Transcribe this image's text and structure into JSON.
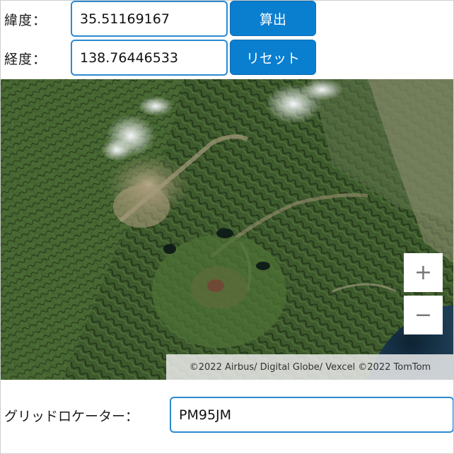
{
  "latitude": {
    "label": "緯度：",
    "value": "35.51169167"
  },
  "longitude": {
    "label": "経度：",
    "value": "138.76446533"
  },
  "buttons": {
    "calculate": "算出",
    "reset": "リセット"
  },
  "map": {
    "zoom_in": "+",
    "zoom_out": "−",
    "attribution": "©2022 Airbus/ Digital Globe/ Vexcel ©2022 TomTom"
  },
  "grid_locator": {
    "label": "グリッドロケーター：",
    "value": "PM95JM"
  },
  "icons": {
    "zoom_in": "plus-icon",
    "zoom_out": "minus-icon"
  },
  "colors": {
    "accent": "#0a7fd0",
    "input_border": "#2b8ad0"
  }
}
